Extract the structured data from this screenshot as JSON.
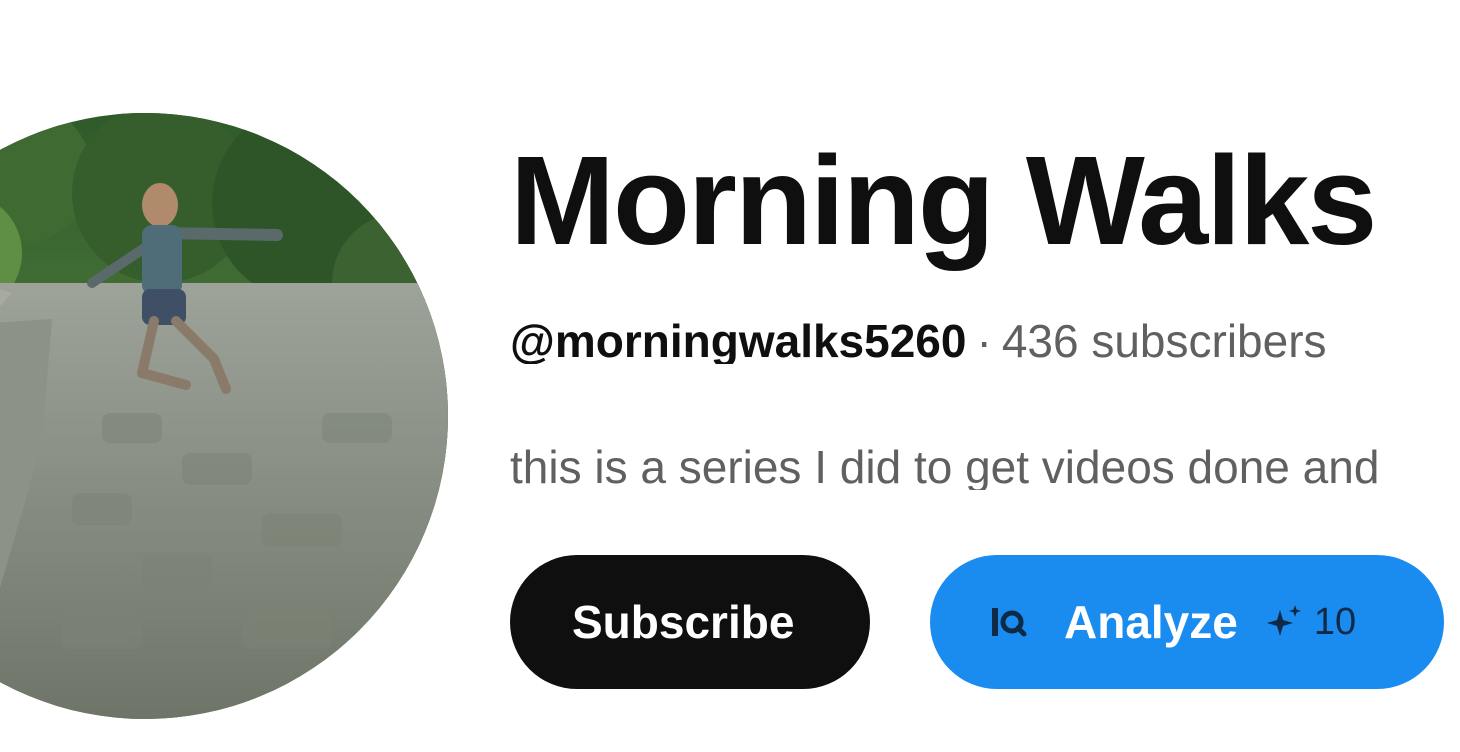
{
  "channel": {
    "title": "Morning Walks",
    "handle": "@morningwalks5260",
    "separator": "·",
    "subscribers": "436 subscribers",
    "description": "this is a series I did to get videos done and"
  },
  "avatar": {
    "alt": "avatar"
  },
  "buttons": {
    "subscribe_label": "Subscribe",
    "analyze_label": "Analyze",
    "analyze_icon": "analyze-icon",
    "credits_icon": "sparkle-icon",
    "credits_count": "10"
  },
  "colors": {
    "subscribe_bg": "#0f0f0f",
    "analyze_bg": "#1a8cf0",
    "text_primary": "#0f0f0f",
    "text_secondary": "#606060"
  }
}
